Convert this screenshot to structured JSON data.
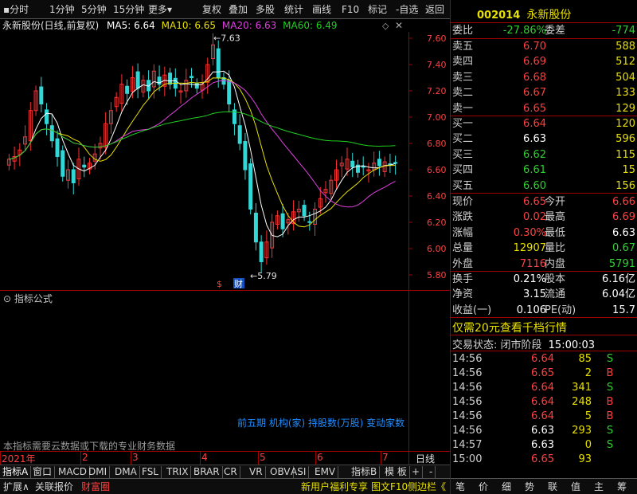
{
  "toolbar": {
    "items": [
      "分时",
      "1分钟",
      "5分钟",
      "15分钟",
      "更多",
      "复权",
      "叠加",
      "多股",
      "统计",
      "画线",
      "F10",
      "标记",
      "-自选",
      "返回"
    ],
    "more_arrow": "▾"
  },
  "chart": {
    "title": "永新股份(日线,前复权)",
    "ma": [
      {
        "label": "MA5: 6.64",
        "color": "#ffffff"
      },
      {
        "label": "MA10: 6.65",
        "color": "#e8e000"
      },
      {
        "label": "MA20: 6.63",
        "color": "#e040e0"
      },
      {
        "label": "MA60: 6.49",
        "color": "#20d020"
      }
    ],
    "y_ticks": [
      "7.60",
      "7.40",
      "7.20",
      "7.00",
      "6.80",
      "6.60",
      "6.40",
      "6.20",
      "6.00",
      "5.80"
    ],
    "high_label": "7.63",
    "low_label": "5.79",
    "event_icons": [
      "$",
      "财"
    ]
  },
  "indicator": {
    "title": "指标公式",
    "note": "本指标需要云数据或下载的专业财务数据",
    "overlay": "前五期 机构(家) 持股数(万股) 变动家数"
  },
  "x_axis": {
    "labels": [
      "2021年",
      "2",
      "3",
      "4",
      "5",
      "6",
      "7"
    ],
    "period": "日线"
  },
  "tabs": [
    "指标A",
    "窗口",
    "MACD",
    "DMI",
    "DMA",
    "FSL",
    "TRIX",
    "BRAR",
    "CR",
    "VR",
    "OBV",
    "ASI",
    "EMV",
    "指标B",
    "模 板",
    "+",
    "-"
  ],
  "status": {
    "left": [
      "扩展∧",
      "关联报价",
      "财富圈"
    ],
    "mid": [
      "新用户福利专享",
      "图文F10",
      "侧边栏《"
    ],
    "right": [
      "笔",
      "价",
      "细",
      "势",
      "联",
      "值",
      "主",
      "筹"
    ]
  },
  "quote": {
    "code": "002014",
    "name": "永新股份",
    "weibi_label": "委比",
    "weibi": "-27.86%",
    "weicha_label": "委差",
    "weicha": "-774",
    "sell": [
      {
        "label": "卖五",
        "price": "6.70",
        "vol": "588"
      },
      {
        "label": "卖四",
        "price": "6.69",
        "vol": "512"
      },
      {
        "label": "卖三",
        "price": "6.68",
        "vol": "504"
      },
      {
        "label": "卖二",
        "price": "6.67",
        "vol": "133"
      },
      {
        "label": "卖一",
        "price": "6.65",
        "vol": "129"
      }
    ],
    "buy": [
      {
        "label": "买一",
        "price": "6.64",
        "vol": "120"
      },
      {
        "label": "买二",
        "price": "6.63",
        "vol": "596"
      },
      {
        "label": "买三",
        "price": "6.62",
        "vol": "115"
      },
      {
        "label": "买四",
        "price": "6.61",
        "vol": "15"
      },
      {
        "label": "买五",
        "price": "6.60",
        "vol": "156"
      }
    ],
    "stats": [
      {
        "l1": "现价",
        "v1": "6.65",
        "l2": "今开",
        "v2": "6.66"
      },
      {
        "l1": "涨跌",
        "v1": "0.02",
        "l2": "最高",
        "v2": "6.69"
      },
      {
        "l1": "涨幅",
        "v1": "0.30%",
        "l2": "最低",
        "v2": "6.63"
      },
      {
        "l1": "总量",
        "v1": "12907",
        "l2": "量比",
        "v2": "0.67"
      },
      {
        "l1": "外盘",
        "v1": "7116",
        "l2": "内盘",
        "v2": "5791"
      }
    ],
    "fin": [
      {
        "l1": "换手",
        "v1": "0.21%",
        "l2": "股本",
        "v2": "6.16亿"
      },
      {
        "l1": "净资",
        "v1": "3.15",
        "l2": "流通",
        "v2": "6.04亿"
      },
      {
        "l1": "收益(一)",
        "v1": "0.106",
        "l2": "PE(动)",
        "v2": "15.7"
      }
    ],
    "promo": "仅需20元查看千档行情",
    "trade_status": "交易状态: 闭市阶段",
    "trade_time": "15:00:03",
    "ticks": [
      {
        "t": "14:56",
        "p": "6.64",
        "q": "85",
        "s": "S"
      },
      {
        "t": "14:56",
        "p": "6.65",
        "q": "2",
        "s": "B"
      },
      {
        "t": "14:56",
        "p": "6.64",
        "q": "341",
        "s": "S"
      },
      {
        "t": "14:56",
        "p": "6.64",
        "q": "248",
        "s": "B"
      },
      {
        "t": "14:56",
        "p": "6.64",
        "q": "5",
        "s": "B"
      },
      {
        "t": "14:56",
        "p": "6.63",
        "q": "293",
        "s": "S"
      },
      {
        "t": "14:57",
        "p": "6.63",
        "q": "0",
        "s": "S"
      },
      {
        "t": "15:00",
        "p": "6.65",
        "q": "93",
        "s": ""
      }
    ]
  }
}
